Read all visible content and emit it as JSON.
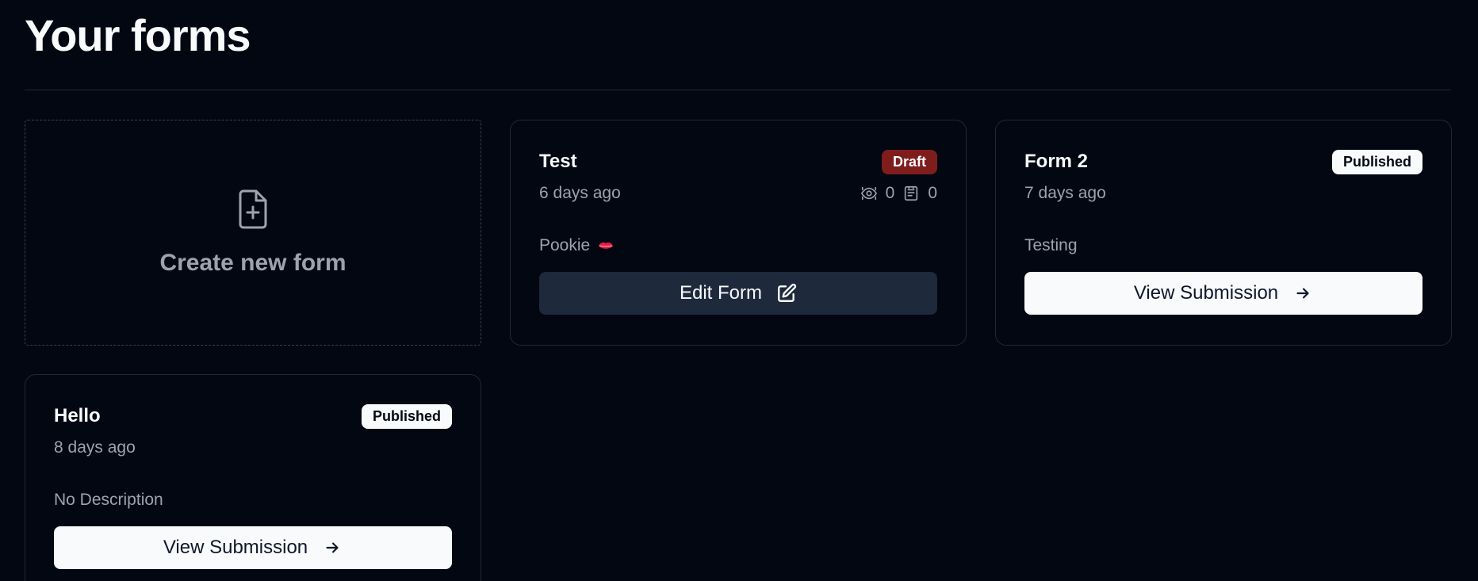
{
  "page": {
    "title": "Your forms"
  },
  "create_card": {
    "label": "Create new form",
    "icon": "file-plus-icon"
  },
  "forms": [
    {
      "title": "Test",
      "status": "Draft",
      "ago": "6 days ago",
      "views": "0",
      "submissions": "0",
      "description": "Pookie",
      "description_emoji": "lips-icon",
      "button_label": "Edit Form",
      "button_icon": "edit-icon"
    },
    {
      "title": "Form 2",
      "status": "Published",
      "ago": "7 days ago",
      "description": "Testing",
      "button_label": "View Submission",
      "button_icon": "arrow-right-icon"
    },
    {
      "title": "Hello",
      "status": "Published",
      "ago": "8 days ago",
      "description": "No Description",
      "button_label": "View Submission",
      "button_icon": "arrow-right-icon"
    }
  ],
  "colors": {
    "background": "#030712",
    "draft_badge": "#7f1d1d",
    "published_badge": "#f8fafc",
    "edit_button": "#1e293b",
    "muted_text": "#9ca3af"
  }
}
